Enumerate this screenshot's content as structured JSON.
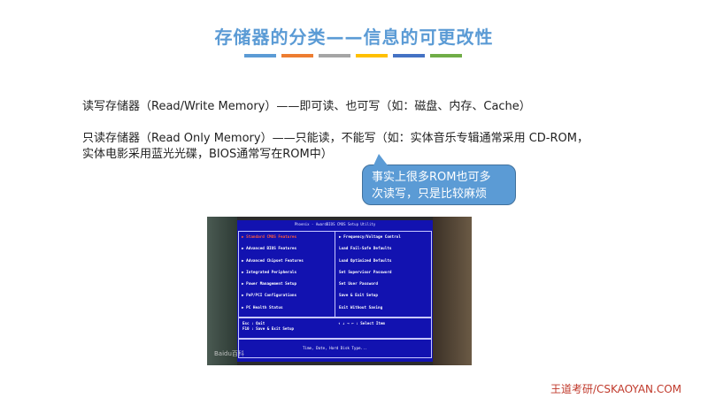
{
  "slide": {
    "title": "存储器的分类——信息的可更改性",
    "bar_colors": [
      "#5b9bd5",
      "#ed7d31",
      "#a5a5a5",
      "#ffc000",
      "#4472c4",
      "#70ad47"
    ],
    "line1": "读写存储器（Read/Write Memory）——即可读、也可写（如：磁盘、内存、Cache）",
    "line2": "只读存储器（Read Only Memory）——只能读，不能写（如：实体音乐专辑通常采用 CD-ROM，",
    "line3": "实体电影采用蓝光光碟，BIOS通常写在ROM中）",
    "callout_line1": "事实上很多ROM也可多",
    "callout_line2": "次读写，只是比较麻烦",
    "footer": "王道考研/CSKAOYAN.COM"
  },
  "bios_photo": {
    "header": "Phoenix - AwardBIOS CMOS Setup Utility",
    "left_items": [
      "▶ Standard CMOS Features",
      "▶ Advanced BIOS Features",
      "▶ Advanced Chipset Features",
      "▶ Integrated Peripherals",
      "▶ Power Management Setup",
      "▶ PnP/PCI Configurations",
      "▶ PC Health Status"
    ],
    "right_items": [
      "▶ Frequency/Voltage Control",
      "Load Fail-Safe Defaults",
      "Load Optimized Defaults",
      "Set Supervisor Password",
      "Set User Password",
      "Save & Exit Setup",
      "Exit Without Saving"
    ],
    "hint_esc": "Esc : Quit",
    "hint_f10": "F10 : Save & Exit Setup",
    "hint_select": "↑ ↓ → ←   : Select Item",
    "description": "Time, Date, Hard Disk Type...",
    "watermark": "Baidu百科"
  }
}
